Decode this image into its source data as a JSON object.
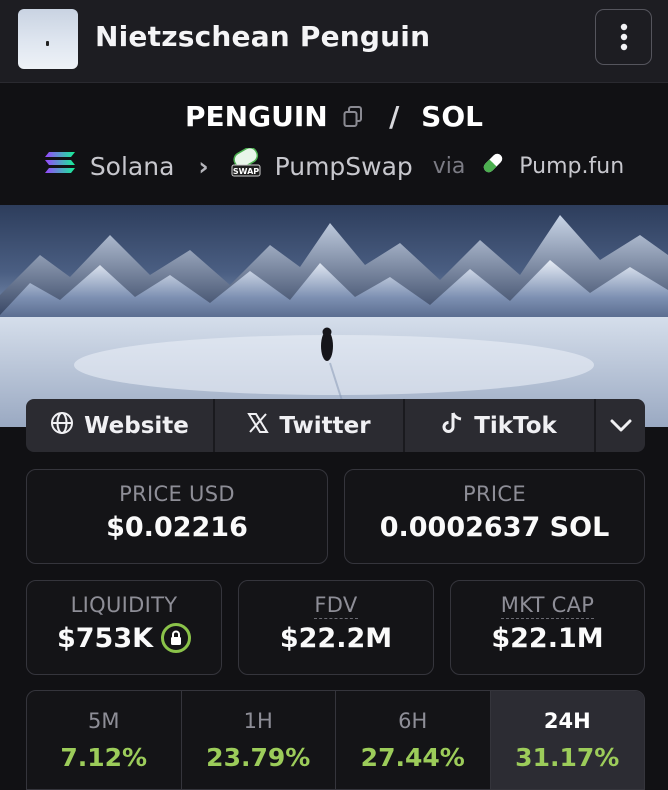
{
  "header": {
    "title": "Nietzschean Penguin"
  },
  "pair": {
    "base": "PENGUIN",
    "separator": "/",
    "quote": "SOL"
  },
  "chain": {
    "network": "Solana",
    "dex": "PumpSwap",
    "dex_badge": "SWAP",
    "via": "via",
    "launchpad": "Pump.fun"
  },
  "links": {
    "website": "Website",
    "twitter": "Twitter",
    "tiktok": "TikTok"
  },
  "stats": {
    "price_usd": {
      "label": "PRICE USD",
      "value": "$0.02216"
    },
    "price": {
      "label": "PRICE",
      "value": "0.0002637 SOL"
    },
    "liquidity": {
      "label": "LIQUIDITY",
      "value": "$753K"
    },
    "fdv": {
      "label": "FDV",
      "value": "$22.2M"
    },
    "mkt_cap": {
      "label": "MKT CAP",
      "value": "$22.1M"
    }
  },
  "timeframes": [
    {
      "label": "5M",
      "change": "7.12%"
    },
    {
      "label": "1H",
      "change": "23.79%"
    },
    {
      "label": "6H",
      "change": "27.44%"
    },
    {
      "label": "24H",
      "change": "31.17%",
      "active": true
    }
  ],
  "colors": {
    "positive": "#9ccc5a",
    "lock": "#8bc34a",
    "background": "#111114"
  }
}
